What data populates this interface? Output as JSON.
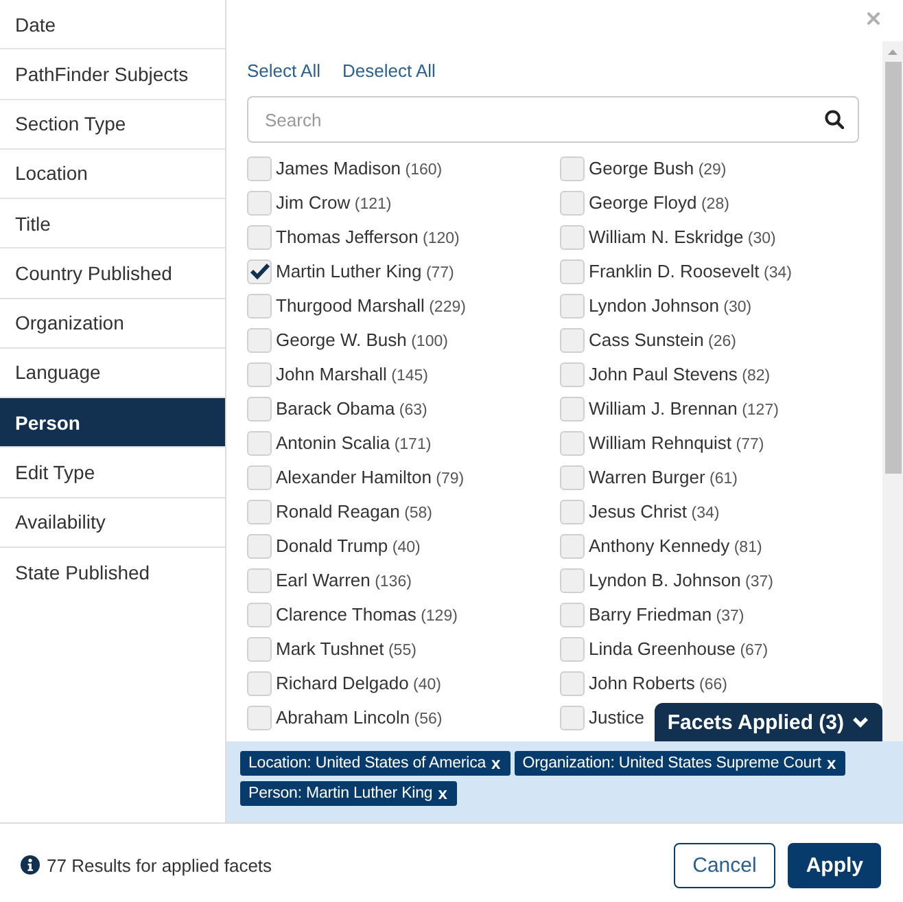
{
  "sidebar": {
    "items": [
      {
        "label": "Date",
        "selected": false
      },
      {
        "label": "PathFinder Subjects",
        "selected": false
      },
      {
        "label": "Section Type",
        "selected": false
      },
      {
        "label": "Location",
        "selected": false
      },
      {
        "label": "Title",
        "selected": false
      },
      {
        "label": "Country Published",
        "selected": false
      },
      {
        "label": "Organization",
        "selected": false
      },
      {
        "label": "Language",
        "selected": false
      },
      {
        "label": "Person",
        "selected": true
      },
      {
        "label": "Edit Type",
        "selected": false
      },
      {
        "label": "Availability",
        "selected": false
      },
      {
        "label": "State Published",
        "selected": false
      }
    ]
  },
  "facet_list": {
    "links": [
      "Select All",
      "Deselect All"
    ],
    "search": {
      "placeholder": "Search"
    },
    "options": [
      {
        "name": "James Madison",
        "count": "(160)",
        "checked": false
      },
      {
        "name": "Jim Crow",
        "count": "(121)",
        "checked": false
      },
      {
        "name": "Thomas Jefferson",
        "count": "(120)",
        "checked": false
      },
      {
        "name": "Martin Luther King",
        "count": "(77)",
        "checked": true
      },
      {
        "name": "Thurgood Marshall",
        "count": "(229)",
        "checked": false
      },
      {
        "name": "George W. Bush",
        "count": "(100)",
        "checked": false
      },
      {
        "name": "John Marshall",
        "count": "(145)",
        "checked": false
      },
      {
        "name": "Barack Obama",
        "count": "(63)",
        "checked": false
      },
      {
        "name": "Antonin Scalia",
        "count": "(171)",
        "checked": false
      },
      {
        "name": "Alexander Hamilton",
        "count": "(79)",
        "checked": false
      },
      {
        "name": "Ronald Reagan",
        "count": "(58)",
        "checked": false
      },
      {
        "name": "Donald Trump",
        "count": "(40)",
        "checked": false
      },
      {
        "name": "Earl Warren",
        "count": "(136)",
        "checked": false
      },
      {
        "name": "Clarence Thomas",
        "count": "(129)",
        "checked": false
      },
      {
        "name": "Mark Tushnet",
        "count": "(55)",
        "checked": false
      },
      {
        "name": "Richard Delgado",
        "count": "(40)",
        "checked": false
      },
      {
        "name": "Abraham Lincoln",
        "count": "(56)",
        "checked": false
      },
      {
        "name": "George Bush",
        "count": "(29)",
        "checked": false
      },
      {
        "name": "George Floyd",
        "count": "(28)",
        "checked": false
      },
      {
        "name": "William N. Eskridge",
        "count": "(30)",
        "checked": false
      },
      {
        "name": "Franklin D. Roosevelt",
        "count": "(34)",
        "checked": false
      },
      {
        "name": "Lyndon Johnson",
        "count": "(30)",
        "checked": false
      },
      {
        "name": "Cass Sunstein",
        "count": "(26)",
        "checked": false
      },
      {
        "name": "John Paul Stevens",
        "count": "(82)",
        "checked": false
      },
      {
        "name": "William J. Brennan",
        "count": "(127)",
        "checked": false
      },
      {
        "name": "William Rehnquist",
        "count": "(77)",
        "checked": false
      },
      {
        "name": "Warren Burger",
        "count": "(61)",
        "checked": false
      },
      {
        "name": "Jesus Christ",
        "count": "(34)",
        "checked": false
      },
      {
        "name": "Anthony Kennedy",
        "count": "(81)",
        "checked": false
      },
      {
        "name": "Lyndon B. Johnson",
        "count": "(37)",
        "checked": false
      },
      {
        "name": "Barry Friedman",
        "count": "(37)",
        "checked": false
      },
      {
        "name": "Linda Greenhouse",
        "count": "(67)",
        "checked": false
      },
      {
        "name": "John Roberts",
        "count": "(66)",
        "checked": false
      },
      {
        "name": "Justice",
        "checked": false
      }
    ]
  },
  "facets_applied": {
    "title": "Facets Applied (3)",
    "expanded": true,
    "chips": [
      {
        "label": "Location: United States of America",
        "remove": "x"
      },
      {
        "label": "Organization: United States Supreme Court",
        "remove": "x"
      },
      {
        "label": "Person: Martin Luther King",
        "remove": "x"
      }
    ]
  },
  "footer": {
    "results": "77 Results for applied facets",
    "buttons": [
      {
        "label": "Cancel",
        "kind": "secondary"
      },
      {
        "label": "Apply",
        "kind": "primary"
      }
    ]
  }
}
